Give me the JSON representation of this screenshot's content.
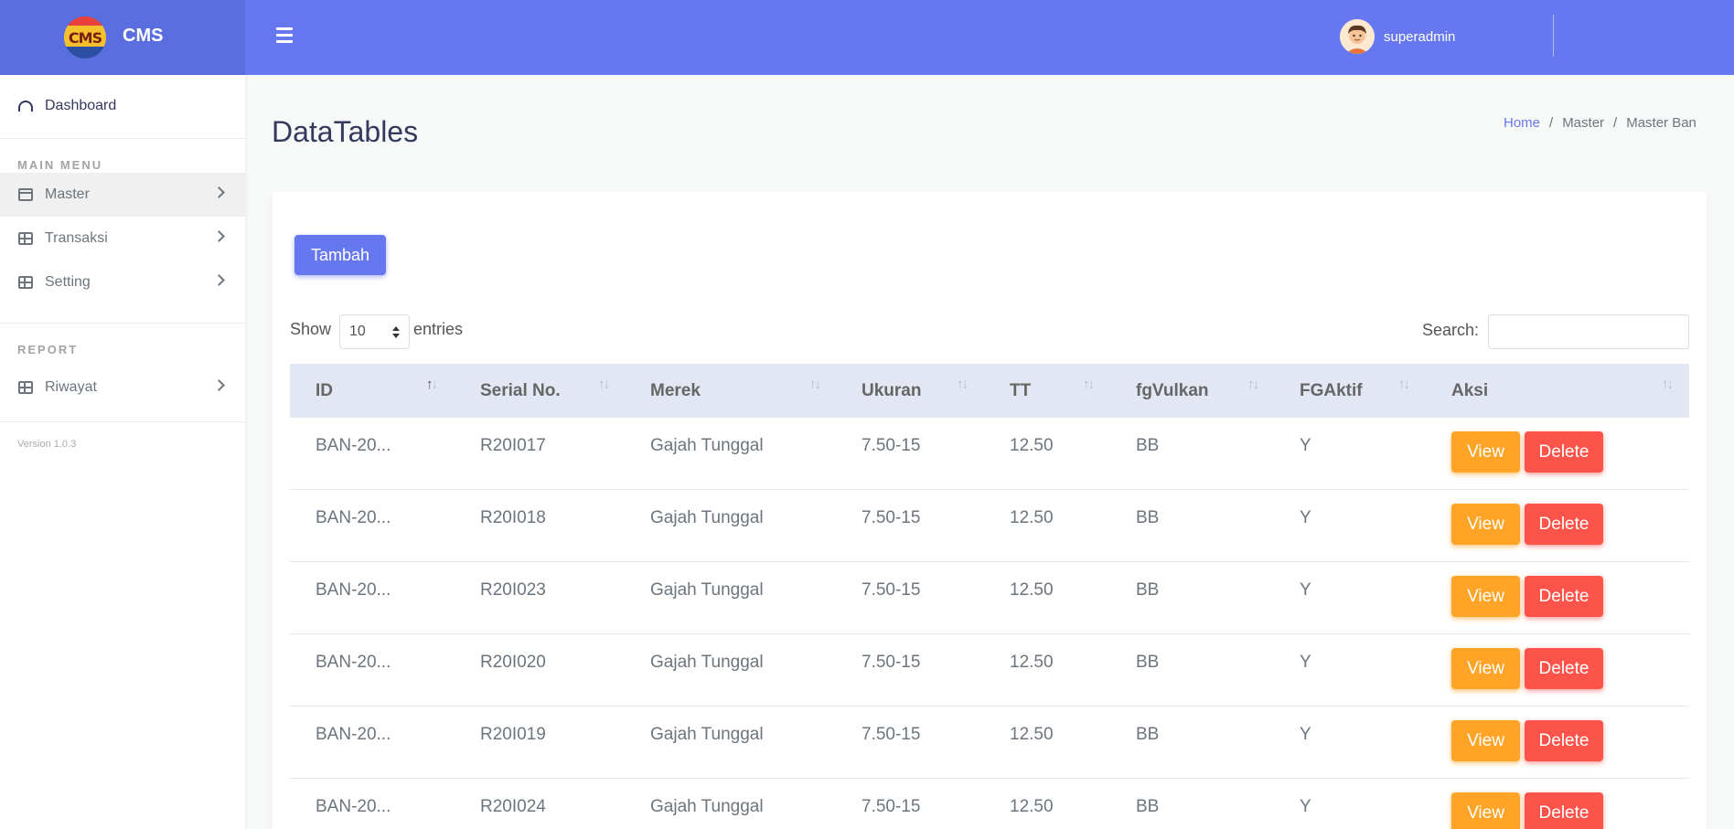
{
  "brand": {
    "logo_text": "CMS",
    "name": "CMS"
  },
  "header": {
    "username": "superadmin"
  },
  "sidebar": {
    "dashboard": "Dashboard",
    "main_menu_header": "MAIN MENU",
    "items": [
      {
        "label": "Master"
      },
      {
        "label": "Transaksi"
      },
      {
        "label": "Setting"
      }
    ],
    "report_header": "REPORT",
    "report_items": [
      {
        "label": "Riwayat"
      }
    ],
    "version": "Version 1.0.3"
  },
  "page": {
    "title": "DataTables",
    "breadcrumb": [
      "Home",
      "Master",
      "Master Ban"
    ]
  },
  "toolbar": {
    "add_label": "Tambah",
    "show_label": "Show",
    "entries_value": "10",
    "entries_label": "entries",
    "search_label": "Search:",
    "search_value": ""
  },
  "table": {
    "columns": [
      "ID",
      "Serial No.",
      "Merek",
      "Ukuran",
      "TT",
      "fgVulkan",
      "FGAktif",
      "Aksi"
    ],
    "rows": [
      [
        "BAN-20...",
        "R20I017",
        "Gajah Tunggal",
        "7.50-15",
        "12.50",
        "BB",
        "Y"
      ],
      [
        "BAN-20...",
        "R20I018",
        "Gajah Tunggal",
        "7.50-15",
        "12.50",
        "BB",
        "Y"
      ],
      [
        "BAN-20...",
        "R20I023",
        "Gajah Tunggal",
        "7.50-15",
        "12.50",
        "BB",
        "Y"
      ],
      [
        "BAN-20...",
        "R20I020",
        "Gajah Tunggal",
        "7.50-15",
        "12.50",
        "BB",
        "Y"
      ],
      [
        "BAN-20...",
        "R20I019",
        "Gajah Tunggal",
        "7.50-15",
        "12.50",
        "BB",
        "Y"
      ],
      [
        "BAN-20...",
        "R20I024",
        "Gajah Tunggal",
        "7.50-15",
        "12.50",
        "BB",
        "Y"
      ]
    ],
    "view_label": "View",
    "delete_label": "Delete"
  },
  "colors": {
    "primary": "#6777ef",
    "brand": "#5a6ee0",
    "warning": "#ffa426",
    "danger": "#fc544b"
  }
}
